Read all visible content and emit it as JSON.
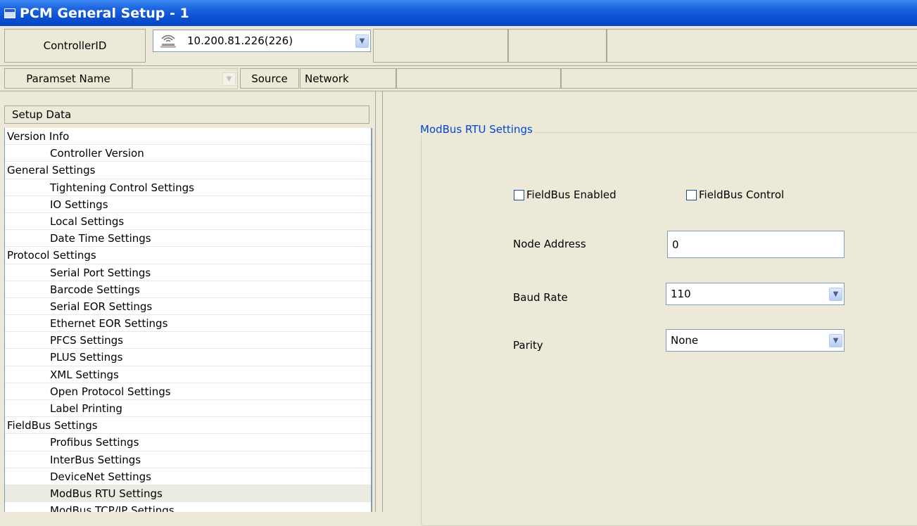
{
  "window": {
    "title": "PCM General Setup - 1"
  },
  "header": {
    "controller_id_label": "ControllerID",
    "controller_value": "10.200.81.226(226)",
    "controller_icon": "network-icon",
    "paramset_label": "Paramset Name",
    "paramset_value": "",
    "source_label": "Source",
    "source_value": "Network"
  },
  "tree": {
    "header": "Setup Data",
    "items": [
      {
        "label": "Version Info",
        "level": 0
      },
      {
        "label": "Controller Version",
        "level": 1
      },
      {
        "label": "General Settings",
        "level": 0
      },
      {
        "label": "Tightening Control Settings",
        "level": 1
      },
      {
        "label": "IO Settings",
        "level": 1
      },
      {
        "label": "Local Settings",
        "level": 1
      },
      {
        "label": "Date Time Settings",
        "level": 1
      },
      {
        "label": "Protocol Settings",
        "level": 0
      },
      {
        "label": "Serial Port Settings",
        "level": 1
      },
      {
        "label": "Barcode Settings",
        "level": 1
      },
      {
        "label": "Serial EOR Settings",
        "level": 1
      },
      {
        "label": "Ethernet EOR Settings",
        "level": 1
      },
      {
        "label": "PFCS Settings",
        "level": 1
      },
      {
        "label": "PLUS Settings",
        "level": 1
      },
      {
        "label": "XML Settings",
        "level": 1
      },
      {
        "label": "Open Protocol Settings",
        "level": 1
      },
      {
        "label": "Label Printing",
        "level": 1
      },
      {
        "label": "FieldBus Settings",
        "level": 0
      },
      {
        "label": "Profibus Settings",
        "level": 1
      },
      {
        "label": "InterBus Settings",
        "level": 1
      },
      {
        "label": "DeviceNet Settings",
        "level": 1
      },
      {
        "label": "ModBus RTU Settings",
        "level": 1,
        "selected": true
      },
      {
        "label": "ModBus TCP/IP Settings",
        "level": 1
      }
    ]
  },
  "modbus": {
    "group_title": "ModBus RTU Settings",
    "fieldbus_enabled_label": "FieldBus Enabled",
    "fieldbus_enabled_checked": false,
    "fieldbus_control_label": "FieldBus Control",
    "fieldbus_control_checked": false,
    "node_address_label": "Node Address",
    "node_address_value": "0",
    "baud_rate_label": "Baud Rate",
    "baud_rate_value": "110",
    "parity_label": "Parity",
    "parity_value": "None"
  }
}
